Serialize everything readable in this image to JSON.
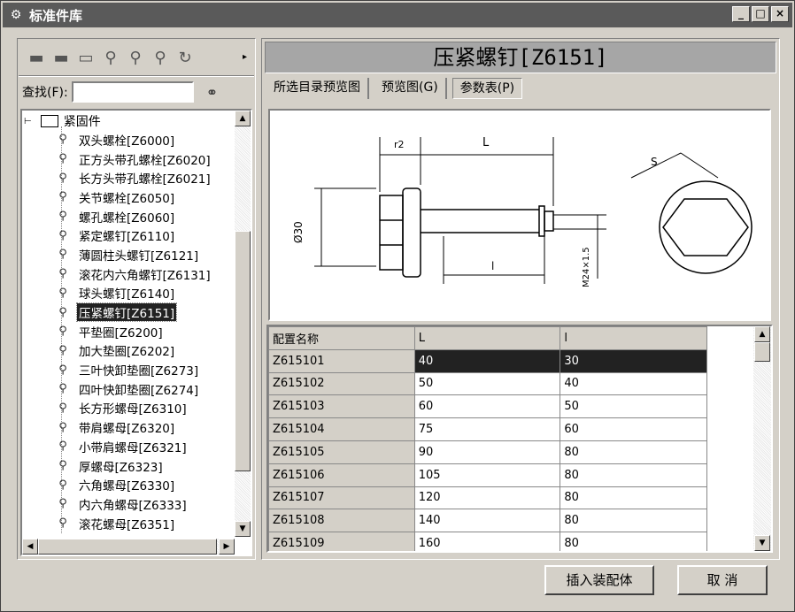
{
  "window": {
    "title": "标准件库",
    "minimize": "_",
    "maximize": "□",
    "close": "×"
  },
  "toolbar": {
    "icons": [
      "folder-icon",
      "folder-icon",
      "folder-open-icon",
      "bolt-icon",
      "bolt-icon",
      "bolt-icon",
      "refresh-icon"
    ],
    "more": "▸"
  },
  "search": {
    "label": "查找(F):",
    "value": "",
    "button_icon": "binoculars-icon"
  },
  "tree": {
    "root": "紧固件",
    "items": [
      "双头螺栓[Z6000]",
      "正方头带孔螺栓[Z6020]",
      "长方头带孔螺栓[Z6021]",
      "关节螺栓[Z6050]",
      "螺孔螺栓[Z6060]",
      "紧定螺钉[Z6110]",
      "薄圆柱头螺钉[Z6121]",
      "滚花内六角螺钉[Z6131]",
      "球头螺钉[Z6140]",
      "压紧螺钉[Z6151]",
      "平垫圈[Z6200]",
      "加大垫圈[Z6202]",
      "三叶快卸垫圈[Z6273]",
      "四叶快卸垫圈[Z6274]",
      "长方形螺母[Z6310]",
      "带肩螺母[Z6320]",
      "小带肩螺母[Z6321]",
      "厚螺母[Z6323]",
      "六角螺母[Z6330]",
      "内六角螺母[Z6333]",
      "滚花螺母[Z6351]"
    ],
    "selected_index": 9
  },
  "header": {
    "title": "压紧螺钉[Z6151]"
  },
  "tabs": [
    {
      "label": "所选目录预览图"
    },
    {
      "label": "预览图(G)"
    },
    {
      "label": "参数表(P)"
    }
  ],
  "drawing": {
    "labels": {
      "r2": "r2",
      "L": "L",
      "dia": "Ø30",
      "l": "l",
      "thread": "M24×1.5",
      "s": "S"
    }
  },
  "grid": {
    "columns": [
      "配置名称",
      "L",
      "l"
    ],
    "rows": [
      [
        "Z615101",
        "40",
        "30"
      ],
      [
        "Z615102",
        "50",
        "40"
      ],
      [
        "Z615103",
        "60",
        "50"
      ],
      [
        "Z615104",
        "75",
        "60"
      ],
      [
        "Z615105",
        "90",
        "80"
      ],
      [
        "Z615106",
        "105",
        "80"
      ],
      [
        "Z615107",
        "120",
        "80"
      ],
      [
        "Z615108",
        "140",
        "80"
      ],
      [
        "Z615109",
        "160",
        "80"
      ]
    ]
  },
  "buttons": {
    "insert": "插入装配体",
    "cancel": "取 消"
  }
}
